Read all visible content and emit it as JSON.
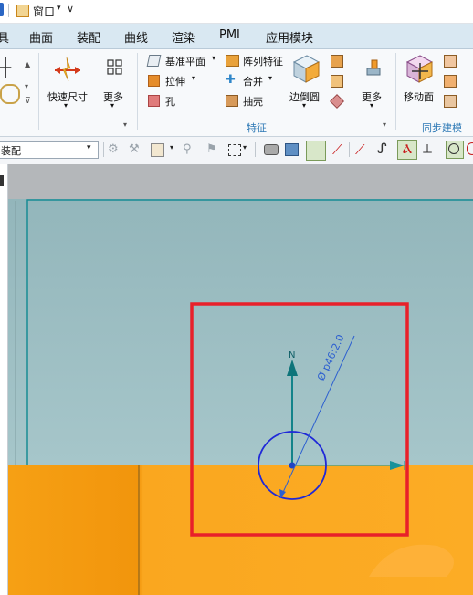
{
  "titlebar": {
    "window_menu": "窗口"
  },
  "menu": [
    "具",
    "曲面",
    "装配",
    "曲线",
    "渲染",
    "PMI",
    "应用模块"
  ],
  "ribbon": {
    "quick_dimension": "快速尺寸",
    "more_1": "更多",
    "datum_plane": "基准平面",
    "extrude": "拉伸",
    "hole": "孔",
    "pattern_feature": "阵列特征",
    "unite": "合并",
    "shell": "抽壳",
    "edge_blend": "边倒圆",
    "more_2": "更多",
    "move_face": "移动面",
    "group_feature": "特征",
    "group_sync": "同步建模"
  },
  "toolbar2": {
    "filter_combo": "装配"
  },
  "sketch": {
    "axis_label": "N",
    "dimension_label": "Ø p46:2.0"
  },
  "colors": {
    "highlight_box": "#e8202a",
    "circle": "#1f28d8",
    "axis": "#13838a",
    "solid_face": "#a1c3c7",
    "solid_bottom": "#f7a11a"
  }
}
